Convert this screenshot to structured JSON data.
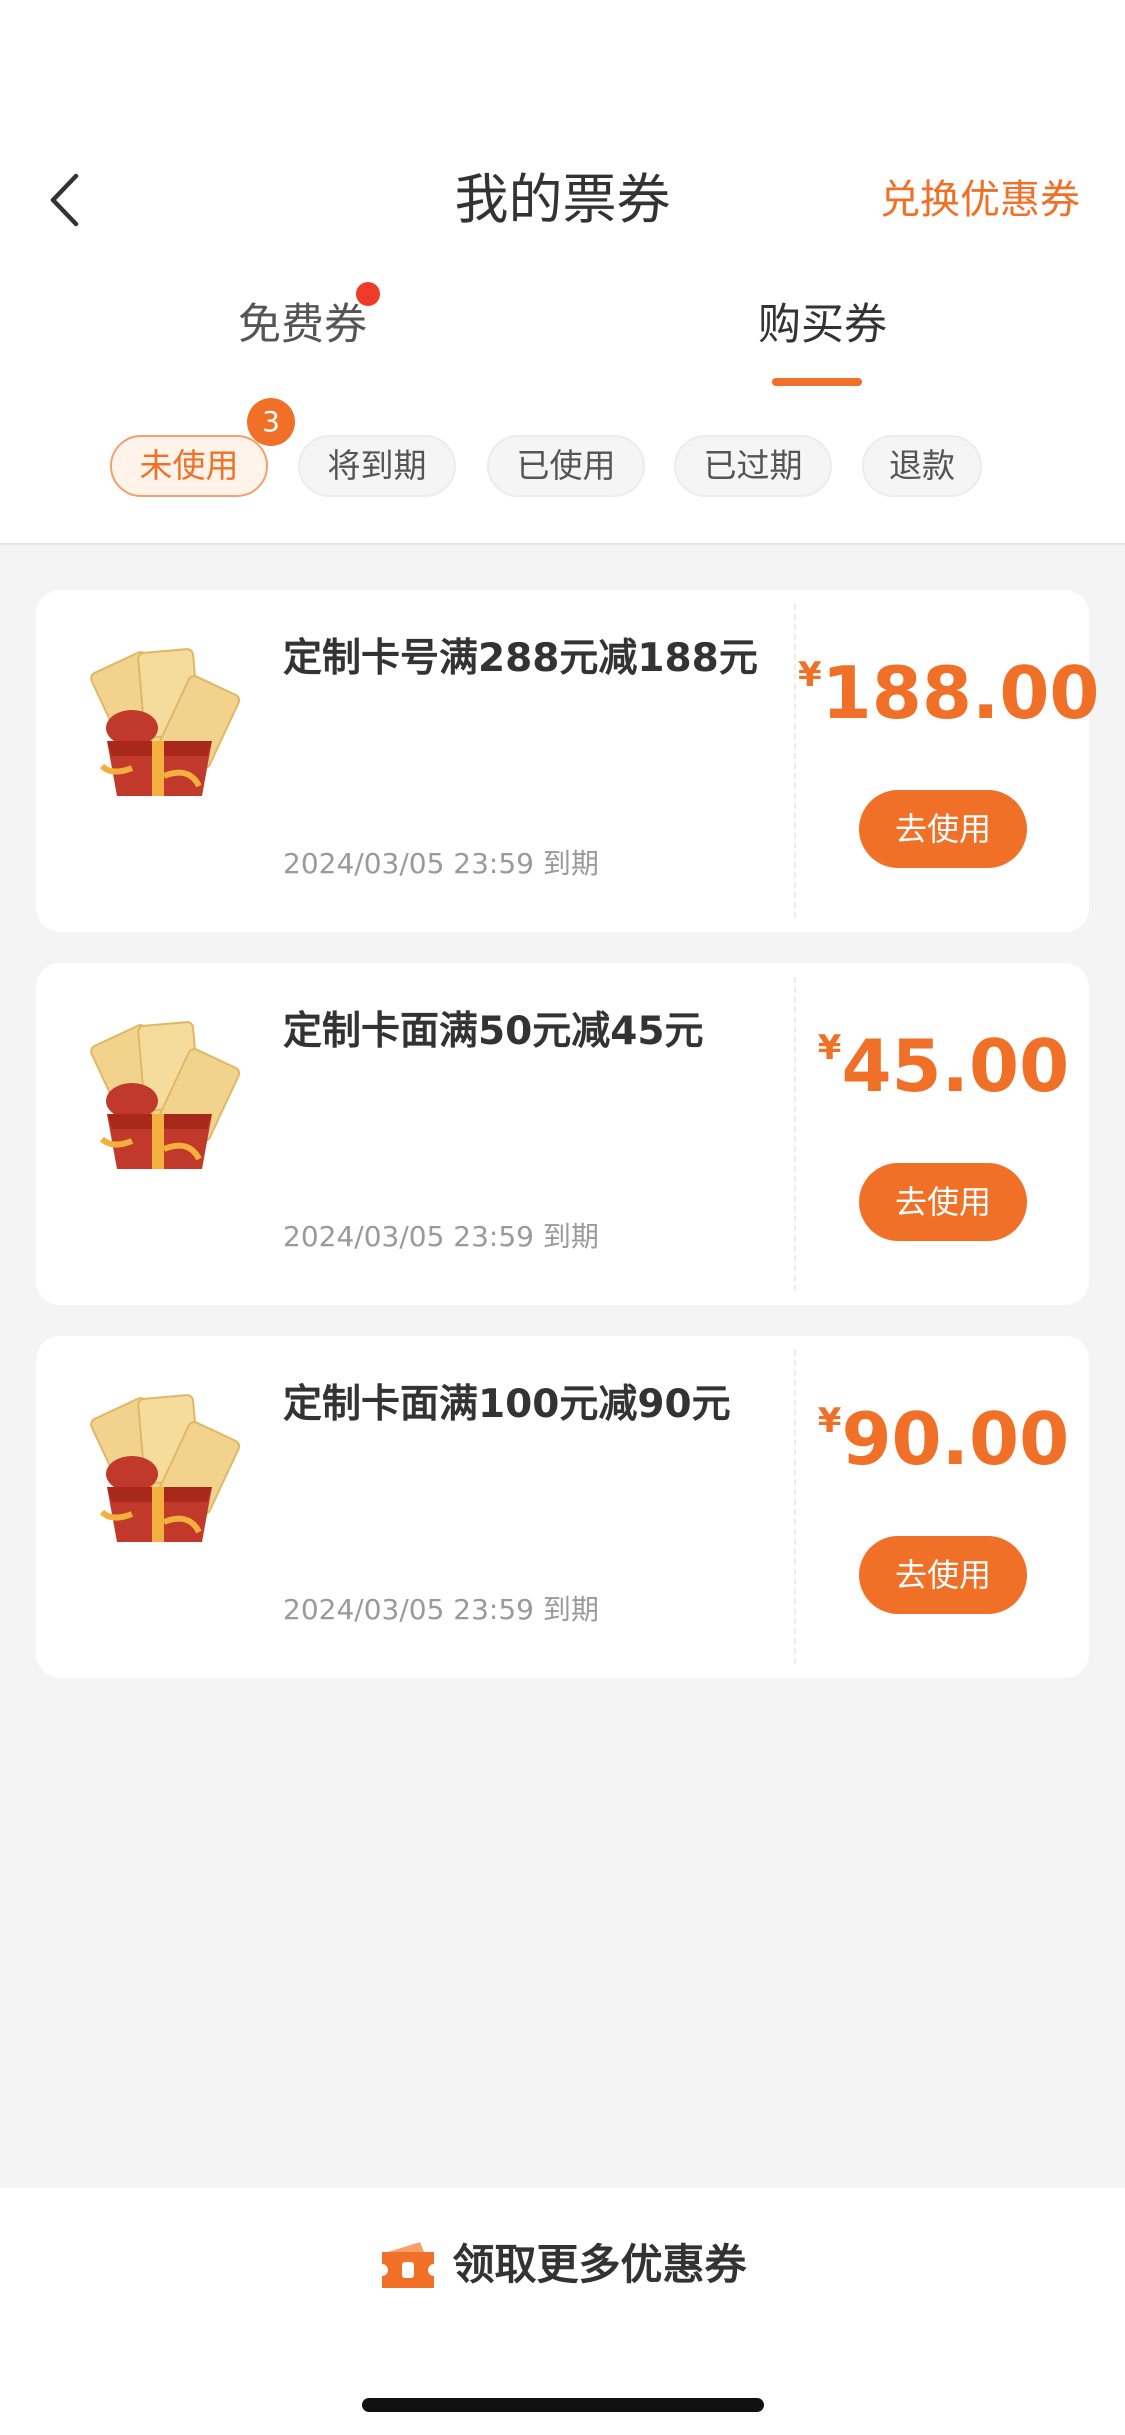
{
  "header": {
    "title": "我的票券",
    "back_icon": "chevron-left-icon",
    "redeem_label": "兑换优惠券"
  },
  "tabs": [
    {
      "label": "免费券",
      "has_dot": true,
      "selected": false
    },
    {
      "label": "购买券",
      "selected": true
    }
  ],
  "filters": [
    {
      "label": "未使用",
      "badge": "3",
      "selected": true
    },
    {
      "label": "将到期"
    },
    {
      "label": "已使用"
    },
    {
      "label": "已过期"
    },
    {
      "label": "退款"
    }
  ],
  "coupons": [
    {
      "title": "定制卡号满288元减188元",
      "expiry": "2024/03/05 23:59 到期",
      "currency": "¥",
      "amount": "188.00",
      "button": "去使用",
      "icon": "gift-box-coupons-icon"
    },
    {
      "title": "定制卡面满50元减45元",
      "expiry": "2024/03/05 23:59 到期",
      "currency": "¥",
      "amount": "45.00",
      "button": "去使用",
      "icon": "gift-box-coupons-icon"
    },
    {
      "title": "定制卡面满100元减90元",
      "expiry": "2024/03/05 23:59 到期",
      "currency": "¥",
      "amount": "90.00",
      "button": "去使用",
      "icon": "gift-box-coupons-icon"
    }
  ],
  "footer": {
    "more_label": "领取更多优惠券",
    "icon": "ticket-icon"
  },
  "colors": {
    "accent": "#f07028",
    "dot": "#f03a2a",
    "background": "#f4f4f4"
  }
}
